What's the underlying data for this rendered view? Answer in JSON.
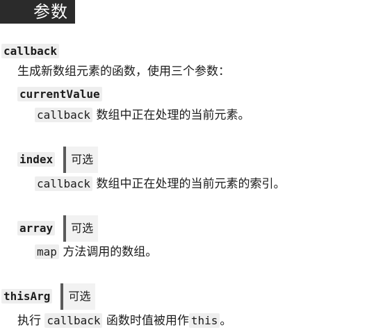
{
  "section": {
    "heading": "参数"
  },
  "params": {
    "callback": {
      "name": "callback",
      "description": "生成新数组元素的函数，使用三个参数："
    },
    "currentValue": {
      "name": "currentValue",
      "code": "callback",
      "description": "数组中正在处理的当前元素。"
    },
    "index": {
      "name": "index",
      "badge": "可选",
      "code": "callback",
      "description": "数组中正在处理的当前元素的索引。"
    },
    "array": {
      "name": "array",
      "badge": "可选",
      "code": "map",
      "description": "方法调用的数组。"
    },
    "thisArg": {
      "name": "thisArg",
      "badge": "可选",
      "prefix": "执行",
      "code": "callback",
      "middle": "函数时值被用作",
      "code2": "this",
      "suffix": "。"
    }
  }
}
